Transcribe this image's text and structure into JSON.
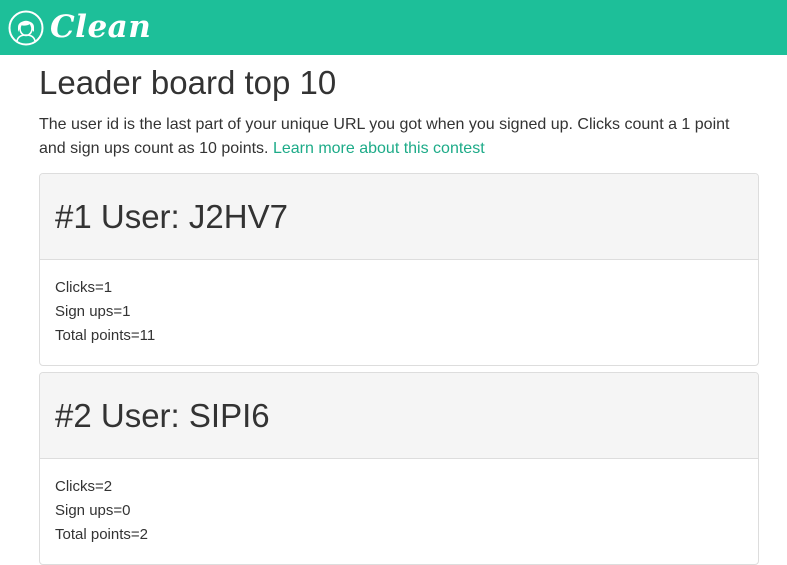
{
  "header": {
    "brand_name": "Clean",
    "brand_color": "#1dbf99",
    "logo_icon": "woman-face-icon"
  },
  "main": {
    "title": "Leader board top 10",
    "intro_text": "The user id is the last part of your unique URL you got when you signed up. Clicks count a 1 point and sign ups count as 10 points.",
    "intro_link": "Learn more about this contest",
    "link_color": "#1dab88"
  },
  "leaders": [
    {
      "heading": "#1 User: J2HV7",
      "clicks": "Clicks=1",
      "signups": "Sign ups=1",
      "total": "Total points=11"
    },
    {
      "heading": "#2 User: SIPI6",
      "clicks": "Clicks=2",
      "signups": "Sign ups=0",
      "total": "Total points=2"
    }
  ]
}
